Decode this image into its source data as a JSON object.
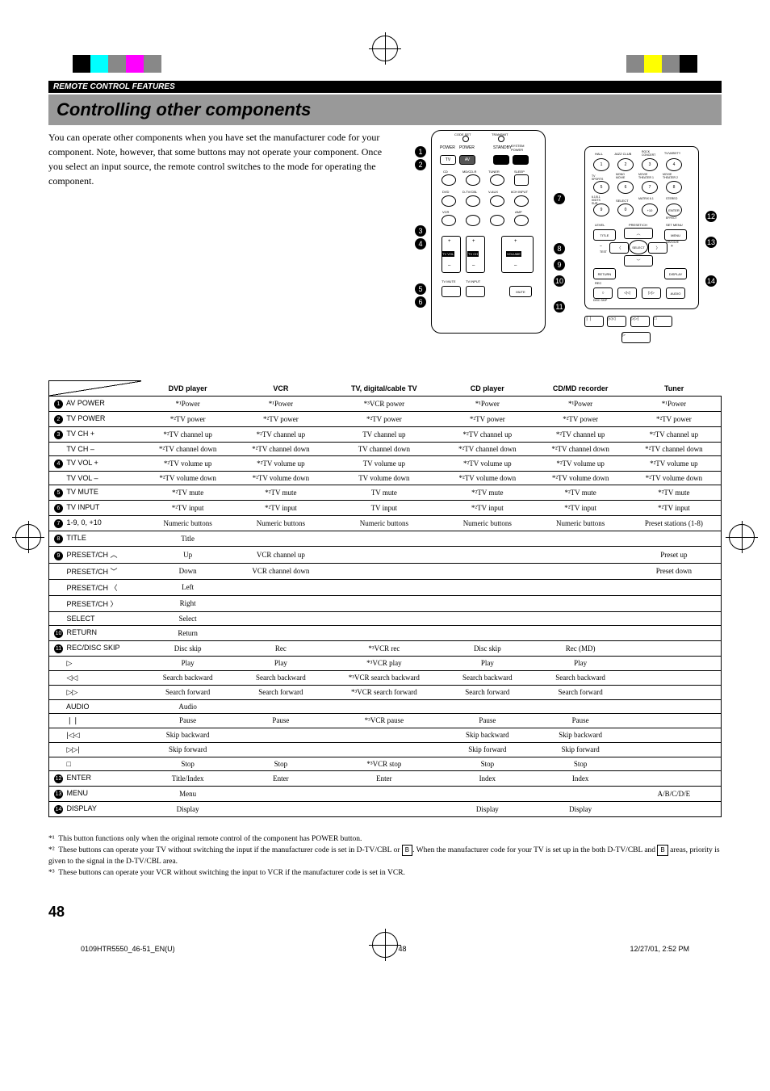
{
  "section_header": "REMOTE CONTROL FEATURES",
  "main_title": "Controlling other components",
  "intro": "You can operate other components when you have set the manufacturer code for your component. Note, however, that some buttons may not operate your component. Once you select an input source, the remote control switches to the mode for operating the component.",
  "columns": [
    "DVD player",
    "VCR",
    "TV, digital/cable TV",
    "CD player",
    "CD/MD recorder",
    "Tuner"
  ],
  "rows": [
    {
      "n": "1",
      "label": "AV POWER",
      "cells": [
        "*¹Power",
        "*¹Power",
        "*³VCR power",
        "*¹Power",
        "*¹Power",
        "*¹Power"
      ]
    },
    {
      "n": "2",
      "label": "TV POWER",
      "cells": [
        "*²TV power",
        "*²TV power",
        "*²TV power",
        "*²TV power",
        "*²TV power",
        "*²TV power"
      ]
    },
    {
      "n": "3",
      "label": "TV CH +",
      "cells": [
        "*²TV channel up",
        "*²TV channel up",
        "TV channel up",
        "*²TV channel up",
        "*²TV channel up",
        "*²TV channel up"
      ]
    },
    {
      "n": "",
      "label": "TV CH –",
      "cells": [
        "*²TV channel down",
        "*²TV channel down",
        "TV channel down",
        "*²TV channel down",
        "*²TV channel down",
        "*²TV channel down"
      ]
    },
    {
      "n": "4",
      "label": "TV VOL +",
      "cells": [
        "*²TV volume up",
        "*²TV volume up",
        "TV volume up",
        "*²TV volume up",
        "*²TV volume up",
        "*²TV volume up"
      ]
    },
    {
      "n": "",
      "label": "TV VOL –",
      "cells": [
        "*²TV volume down",
        "*²TV volume down",
        "TV volume down",
        "*²TV volume down",
        "*²TV volume down",
        "*²TV volume down"
      ]
    },
    {
      "n": "5",
      "label": "TV MUTE",
      "cells": [
        "*²TV mute",
        "*²TV mute",
        "TV mute",
        "*²TV mute",
        "*²TV mute",
        "*²TV mute"
      ]
    },
    {
      "n": "6",
      "label": "TV INPUT",
      "cells": [
        "*²TV input",
        "*²TV input",
        "TV input",
        "*²TV input",
        "*²TV input",
        "*²TV input"
      ]
    },
    {
      "n": "7",
      "label": "1-9, 0, +10",
      "cells": [
        "Numeric buttons",
        "Numeric buttons",
        "Numeric buttons",
        "Numeric buttons",
        "Numeric buttons",
        "Preset stations (1-8)"
      ]
    },
    {
      "n": "8",
      "label": "TITLE",
      "cells": [
        "Title",
        "",
        "",
        "",
        "",
        ""
      ]
    },
    {
      "n": "9",
      "label": "PRESET/CH ︿",
      "cells": [
        "Up",
        "VCR channel up",
        "",
        "",
        "",
        "Preset up"
      ]
    },
    {
      "n": "",
      "label": "PRESET/CH ﹀",
      "cells": [
        "Down",
        "VCR channel down",
        "",
        "",
        "",
        "Preset down"
      ]
    },
    {
      "n": "",
      "label": "PRESET/CH 〈",
      "cells": [
        "Left",
        "",
        "",
        "",
        "",
        ""
      ]
    },
    {
      "n": "",
      "label": "PRESET/CH 〉",
      "cells": [
        "Right",
        "",
        "",
        "",
        "",
        ""
      ]
    },
    {
      "n": "",
      "label": "SELECT",
      "cells": [
        "Select",
        "",
        "",
        "",
        "",
        ""
      ]
    },
    {
      "n": "10",
      "label": "RETURN",
      "cells": [
        "Return",
        "",
        "",
        "",
        "",
        ""
      ]
    },
    {
      "n": "11",
      "label": "REC/DISC SKIP",
      "cells": [
        "Disc skip",
        "Rec",
        "*³VCR rec",
        "Disc skip",
        "Rec (MD)",
        ""
      ]
    },
    {
      "n": "",
      "label": "▷",
      "cells": [
        "Play",
        "Play",
        "*³VCR play",
        "Play",
        "Play",
        ""
      ]
    },
    {
      "n": "",
      "label": "◁◁",
      "cells": [
        "Search backward",
        "Search backward",
        "*³VCR search backward",
        "Search backward",
        "Search backward",
        ""
      ]
    },
    {
      "n": "",
      "label": "▷▷",
      "cells": [
        "Search forward",
        "Search forward",
        "*³VCR search forward",
        "Search forward",
        "Search forward",
        ""
      ]
    },
    {
      "n": "",
      "label": "AUDIO",
      "cells": [
        "Audio",
        "",
        "",
        "",
        "",
        ""
      ]
    },
    {
      "n": "",
      "label": "❘❘",
      "cells": [
        "Pause",
        "Pause",
        "*³VCR pause",
        "Pause",
        "Pause",
        ""
      ]
    },
    {
      "n": "",
      "label": "|◁◁",
      "cells": [
        "Skip backward",
        "",
        "",
        "Skip backward",
        "Skip backward",
        ""
      ]
    },
    {
      "n": "",
      "label": "▷▷|",
      "cells": [
        "Skip forward",
        "",
        "",
        "Skip forward",
        "Skip forward",
        ""
      ]
    },
    {
      "n": "",
      "label": "□",
      "cells": [
        "Stop",
        "Stop",
        "*³VCR stop",
        "Stop",
        "Stop",
        ""
      ]
    },
    {
      "n": "12",
      "label": "ENTER",
      "cells": [
        "Title/Index",
        "Enter",
        "Enter",
        "Index",
        "Index",
        ""
      ]
    },
    {
      "n": "13",
      "label": "MENU",
      "cells": [
        "Menu",
        "",
        "",
        "",
        "",
        "A/B/C/D/E"
      ]
    },
    {
      "n": "14",
      "label": "DISPLAY",
      "cells": [
        "Display",
        "",
        "",
        "Display",
        "Display",
        ""
      ]
    }
  ],
  "footnotes": {
    "f1": "This button functions only when the original remote control of the component has POWER button.",
    "f2a": "These buttons can operate your TV without switching the input if the manufacturer code is set in D-TV/CBL or ",
    "f2b": ". When the manufacturer code for your TV is set up in the both D-TV/CBL and ",
    "f2c": " areas, priority is given to the signal in the D-TV/CBL area.",
    "f3": "These buttons can operate your VCR without switching the input to VCR if the manufacturer code is set in VCR."
  },
  "page_number": "48",
  "footer": {
    "file": "0109HTR5550_46-51_EN(U)",
    "page": "48",
    "timestamp": "12/27/01, 2:52 PM"
  },
  "callouts": [
    "1",
    "2",
    "3",
    "4",
    "5",
    "6",
    "7",
    "8",
    "9",
    "10",
    "11",
    "12",
    "13",
    "14"
  ]
}
